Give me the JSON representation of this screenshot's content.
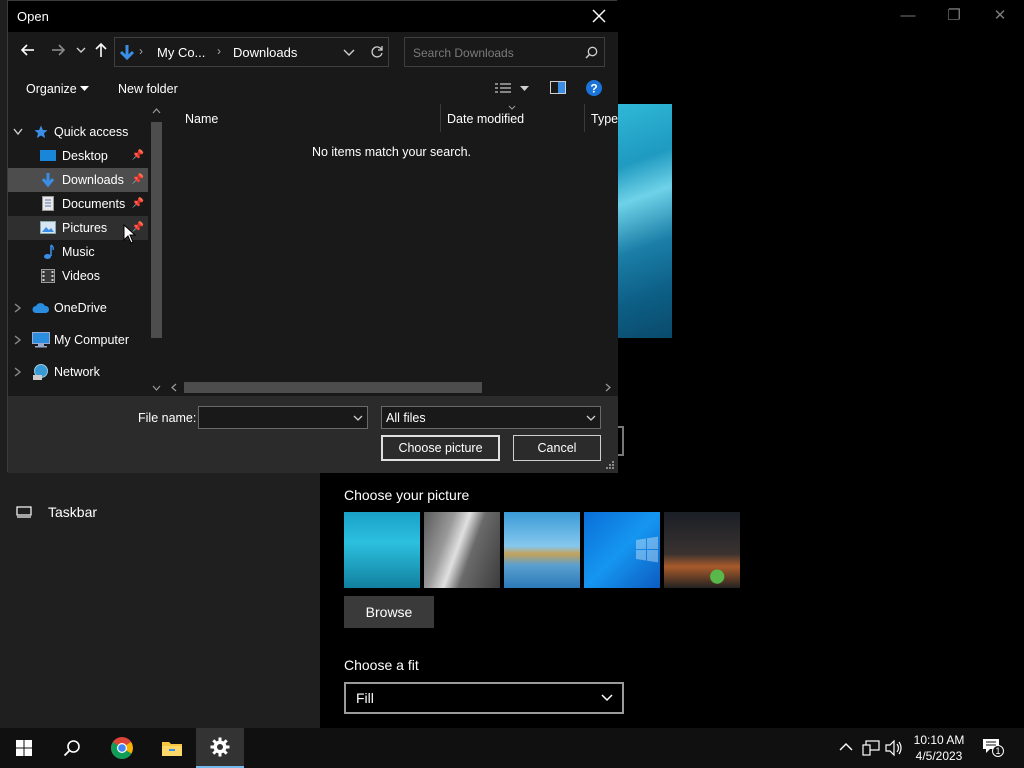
{
  "dialog": {
    "title": "Open",
    "breadcrumb": [
      "My Co...",
      "Downloads"
    ],
    "search_placeholder": "Search Downloads",
    "commands": {
      "organize": "Organize",
      "new_folder": "New folder"
    },
    "nav_tree": [
      {
        "label": "Quick access",
        "icon": "star-icon",
        "expanded": true
      },
      {
        "label": "Desktop",
        "icon": "desktop-folder-icon",
        "pinned": true
      },
      {
        "label": "Downloads",
        "icon": "download-arrow-icon",
        "pinned": true,
        "selected": true
      },
      {
        "label": "Documents",
        "icon": "document-icon",
        "pinned": true
      },
      {
        "label": "Pictures",
        "icon": "pictures-icon",
        "pinned": true,
        "hovered": true
      },
      {
        "label": "Music",
        "icon": "music-note-icon"
      },
      {
        "label": "Videos",
        "icon": "video-icon"
      },
      {
        "label": "OneDrive",
        "icon": "cloud-icon"
      },
      {
        "label": "My Computer",
        "icon": "computer-icon"
      },
      {
        "label": "Network",
        "icon": "network-icon"
      }
    ],
    "columns": [
      "Name",
      "Date modified",
      "Type"
    ],
    "empty_message": "No items match your search.",
    "file_name_label": "File name:",
    "file_name_value": "",
    "file_type": "All files",
    "choose_button": "Choose picture",
    "cancel_button": "Cancel"
  },
  "settings": {
    "taskbar_nav_label": "Taskbar",
    "choose_picture_title": "Choose your picture",
    "browse_button": "Browse",
    "choose_fit_title": "Choose a fit",
    "fit_value": "Fill"
  },
  "taskbar": {
    "time": "10:10 AM",
    "date": "4/5/2023",
    "notification_count": "1"
  },
  "colors": {
    "accent": "#76b9ed",
    "folder_blue": "#3a8ee6",
    "dialog_bg": "#2b2b2b",
    "pane_bg": "#191919"
  }
}
